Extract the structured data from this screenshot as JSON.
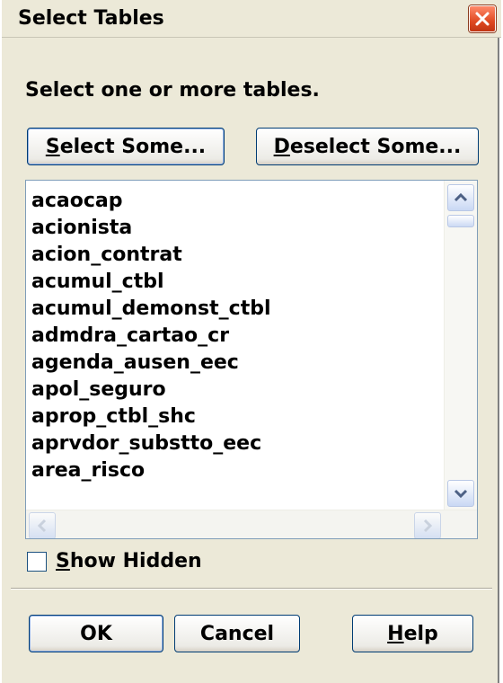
{
  "window": {
    "title": "Select Tables"
  },
  "prompt": "Select one or more tables.",
  "buttons": {
    "select_some_key": "S",
    "select_some_rest": "elect Some...",
    "deselect_some_key": "D",
    "deselect_some_rest": "eselect Some...",
    "ok": "OK",
    "cancel": "Cancel",
    "help_key": "H",
    "help_rest": "elp"
  },
  "tables": [
    "acaocap",
    "acionista",
    "acion_contrat",
    "acumul_ctbl",
    "acumul_demonst_ctbl",
    "admdra_cartao_cr",
    "agenda_ausen_eec",
    "apol_seguro",
    "aprop_ctbl_shc",
    "aprvdor_substto_eec",
    "area_risco"
  ],
  "show_hidden": {
    "key": "S",
    "rest": "how Hidden",
    "checked": false
  },
  "icons": {
    "close": "close-icon",
    "scroll_up": "chevron-up-icon",
    "scroll_down": "chevron-down-icon",
    "scroll_left": "chevron-left-icon",
    "scroll_right": "chevron-right-icon"
  }
}
